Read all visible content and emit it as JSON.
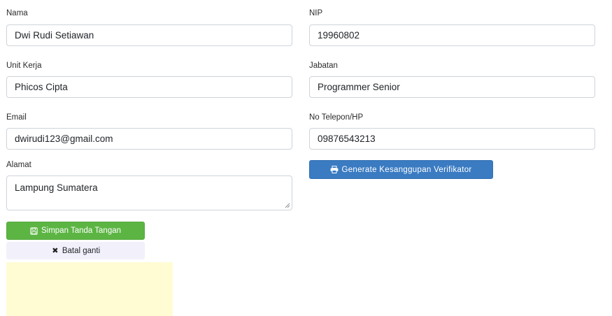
{
  "form": {
    "nama": {
      "label": "Nama",
      "value": "Dwi Rudi Setiawan"
    },
    "nip": {
      "label": "NIP",
      "value": "19960802"
    },
    "unit_kerja": {
      "label": "Unit Kerja",
      "value": "Phicos Cipta"
    },
    "jabatan": {
      "label": "Jabatan",
      "value": "Programmer Senior"
    },
    "email": {
      "label": "Email",
      "value": "dwirudi123@gmail.com"
    },
    "telepon": {
      "label": "No Telepon/HP",
      "value": "09876543213"
    },
    "alamat": {
      "label": "Alamat",
      "value": "Lampung Sumatera"
    }
  },
  "buttons": {
    "generate": {
      "label": "Generate Kesanggupan Verifikator",
      "icon": "printer-icon",
      "color": "#3a7bc2"
    },
    "simpan": {
      "label": "Simpan Tanda Tangan",
      "icon": "save-icon",
      "color": "#5cb543"
    },
    "batal": {
      "label": "Batal ganti",
      "icon": "close-icon"
    }
  },
  "signature_pad": {
    "color": "#fffcd4"
  }
}
